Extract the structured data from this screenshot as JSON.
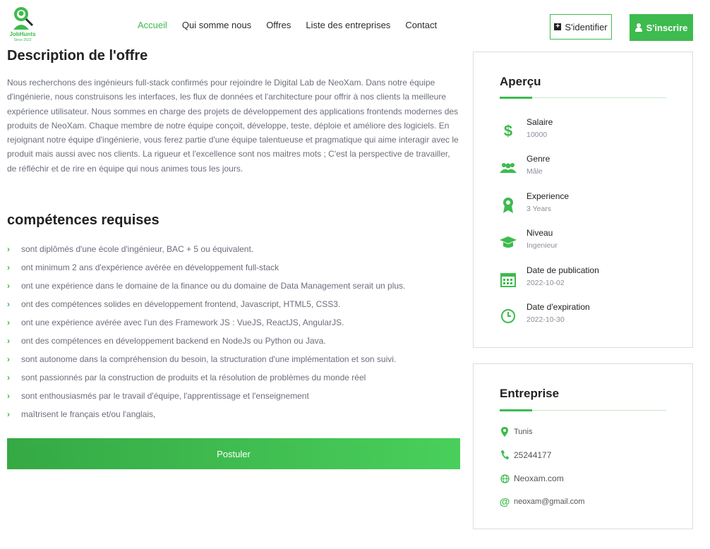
{
  "brand": {
    "name": "JobHunts",
    "tagline": "Since 2022"
  },
  "nav": [
    "Accueil",
    "Qui somme nous",
    "Offres",
    "Liste des entreprises",
    "Contact"
  ],
  "auth": {
    "login": "S'identifier",
    "signup": "S'inscrire"
  },
  "description": {
    "title": "Description de l'offre",
    "text": "Nous recherchons des ingénieurs full-stack confirmés pour rejoindre le Digital Lab de NeoXam. Dans notre équipe d'ingénierie, nous construisons les interfaces, les flux de données et l'architecture pour offrir à nos clients la meilleure expérience utilisateur. Nous sommes en charge des projets de développement des applications frontends modernes des produits de NeoXam. Chaque membre de notre équipe conçoit, développe, teste, déploie et améliore des logiciels. En rejoignant notre équipe d'ingénierie, vous ferez partie d'une équipe talentueuse et pragmatique qui aime interagir avec le produit mais aussi avec nos clients. La rigueur et l'excellence sont nos maitres mots ; C'est la perspective de travailler, de réfléchir et de rire en équipe qui nous animes tous les jours."
  },
  "skills": {
    "title": "compétences requises",
    "items": [
      "sont diplômés d'une école d'ingénieur, BAC + 5 ou équivalent.",
      "ont minimum 2 ans d'expérience avérée en développement full-stack",
      "ont une expérience dans le domaine de la finance ou du domaine de Data Management serait un plus.",
      "ont des compétences solides en développement frontend, Javascript, HTML5, CSS3.",
      "ont une expérience avérée avec l'un des Framework JS : VueJS, ReactJS, AngularJS.",
      "ont des compétences en développement backend en NodeJs ou Python ou Java.",
      "sont autonome dans la compréhension du besoin, la structuration d'une implémentation et son suivi.",
      "sont passionnés par la construction de produits et la résolution de problèmes du monde réel",
      "sont enthousiasmés par le travail d'équipe, l'apprentissage et l'enseignement",
      "maîtrisent le français et/ou l'anglais,"
    ]
  },
  "apply_label": "Postuler",
  "overview": {
    "title": "Aperçu",
    "items": [
      {
        "label": "Salaire",
        "value": "10000",
        "icon": "dollar-icon"
      },
      {
        "label": "Genre",
        "value": "Mâle",
        "icon": "users-icon"
      },
      {
        "label": "Experience",
        "value": "3 Years",
        "icon": "award-icon"
      },
      {
        "label": "Niveau",
        "value": "Ingenieur",
        "icon": "graduation-cap-icon"
      },
      {
        "label": "Date de publication",
        "value": "2022-10-02",
        "icon": "calendar-icon"
      },
      {
        "label": "Date d'expiration",
        "value": "2022-10-30",
        "icon": "clock-icon"
      }
    ]
  },
  "company": {
    "title": "Entreprise",
    "location": "Tunis",
    "phone": "25244177",
    "website": "Neoxam.com",
    "email": "neoxam@gmail.com"
  },
  "colors": {
    "accent": "#3dbb4e"
  }
}
